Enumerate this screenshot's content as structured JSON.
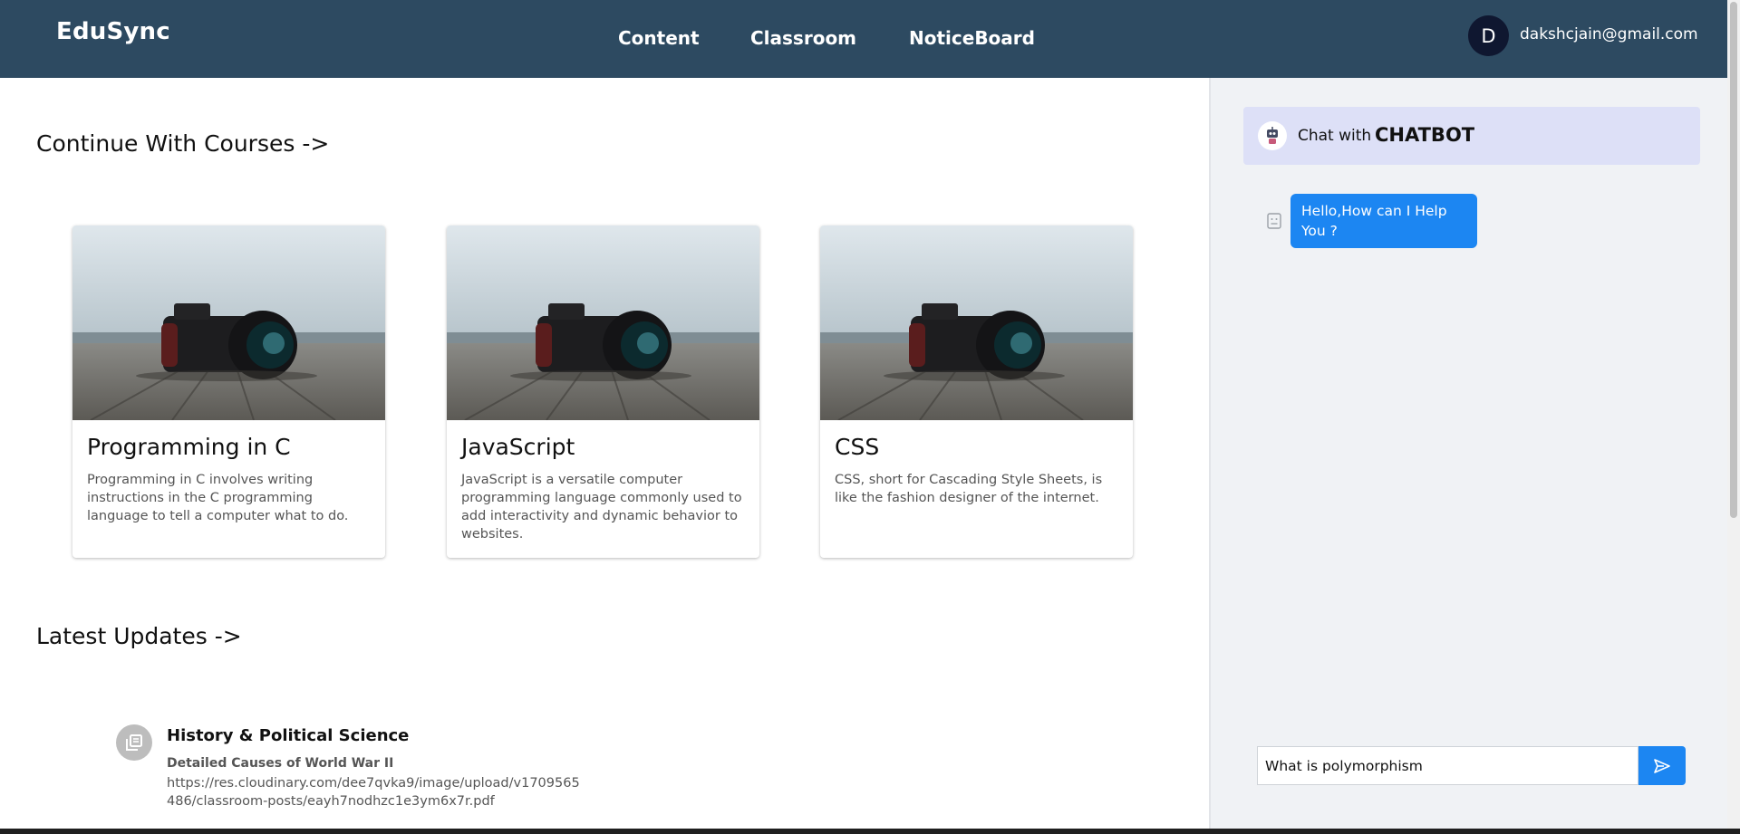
{
  "header": {
    "brand": "EduSync",
    "nav": [
      "Content",
      "Classroom",
      "NoticeBoard"
    ],
    "avatar_initial": "D",
    "user_email": "dakshcjain@gmail.com"
  },
  "courses": {
    "title": "Continue With Courses ->",
    "items": [
      {
        "title": "Programming in C",
        "description": "Programming in C involves writing instructions in the C programming language to tell a computer what to do."
      },
      {
        "title": "JavaScript",
        "description": "JavaScript is a versatile computer programming language commonly used to add interactivity and dynamic behavior to websites."
      },
      {
        "title": "CSS",
        "description": "CSS, short for Cascading Style Sheets, is like the fashion designer of the internet."
      }
    ]
  },
  "updates": {
    "title": "Latest Updates ->",
    "items": [
      {
        "title": "History & Political Science",
        "subtitle": "Detailed Causes of World War II",
        "link": "https://res.cloudinary.com/dee7qvka9/image/upload/v1709565486/classroom-posts/eayh7nodhzc1e3ym6x7r.pdf"
      }
    ]
  },
  "chat": {
    "with_label": "Chat with",
    "bot_name": "CHATBOT",
    "messages": [
      {
        "from": "bot",
        "text": "Hello,How can I Help You ?"
      }
    ],
    "input_value": "What is polymorphism"
  },
  "colors": {
    "topbar": "#2d4a61",
    "accent": "#1c86f2",
    "chat_header": "#dde0f7",
    "chat_bg": "#f0f2f5"
  }
}
